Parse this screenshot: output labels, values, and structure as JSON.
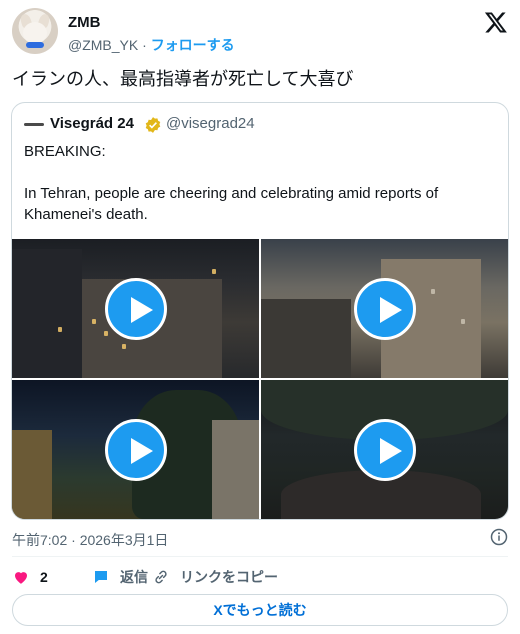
{
  "author": {
    "name": "ZMB",
    "handle": "@ZMB_YK",
    "separator": " · ",
    "follow_label": "フォローする"
  },
  "tweet": {
    "text": "イランの人、最高指導者が死亡して大喜び"
  },
  "quoted": {
    "name": "Visegrád 24",
    "handle": "@visegrad24",
    "lines": [
      "BREAKING:",
      "",
      "In Tehran, people are cheering and celebrating amid reports of",
      "Khamenei's death."
    ],
    "media": [
      {
        "icon": "play-icon"
      },
      {
        "icon": "play-icon"
      },
      {
        "icon": "play-icon"
      },
      {
        "icon": "play-icon"
      }
    ]
  },
  "meta": {
    "timestamp": "午前7:02 · 2026年3月1日"
  },
  "actions": {
    "like_count": "2",
    "reply_label": "返信",
    "copy_link_label": "リンクをコピー"
  },
  "read_more_label": "Xでもっと読む",
  "colors": {
    "accent": "#1d9bf0",
    "like": "#f91880",
    "text_secondary": "#536471",
    "border": "#cfd9de"
  }
}
